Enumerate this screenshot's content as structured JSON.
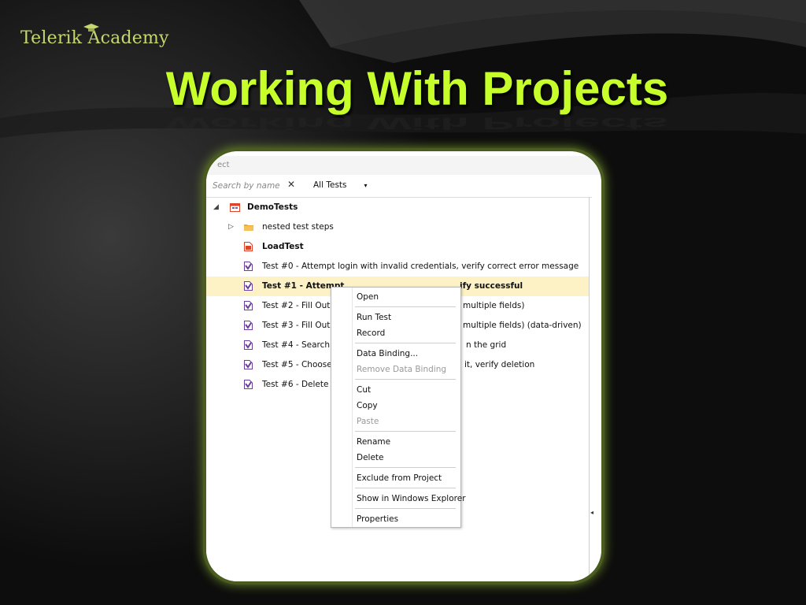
{
  "logo": {
    "text": "Telerik Academy"
  },
  "title": "Working With Projects",
  "panel": {
    "header": "ect",
    "search_placeholder": "Search by name",
    "clear_glyph": "✕",
    "filter": {
      "label": "All Tests",
      "arrow": "▾"
    }
  },
  "tree": {
    "root": "DemoTests",
    "items": [
      {
        "label": "nested test steps",
        "type": "folder"
      },
      {
        "label": "LoadTest",
        "type": "load"
      },
      {
        "label": "Test #0 - Attempt login with invalid credentials, verify correct error message",
        "type": "test"
      },
      {
        "label": "Test #1 - Attempt login with valid credentials, verify successful",
        "type": "test",
        "selected": true,
        "visible_prefix": "Test #1 - Attempt",
        "visible_suffix": "ify successful"
      },
      {
        "label_prefix": "Test #2 - Fill Out a",
        "label_suffix": "multiple fields)",
        "type": "test"
      },
      {
        "label_prefix": "Test #3 - Fill Out a",
        "label_suffix": "multiple fields) (data-driven)",
        "type": "test"
      },
      {
        "label_prefix": "Test #4 - Search a",
        "label_suffix": "n the grid",
        "type": "test"
      },
      {
        "label_prefix": "Test #5 - Choose s",
        "label_suffix": "it, verify deletion",
        "type": "test"
      },
      {
        "label_prefix": "Test #6 - Delete m",
        "type": "test"
      }
    ]
  },
  "context_menu": {
    "items": [
      {
        "label": "Open",
        "enabled": true
      },
      {
        "label": "Run Test",
        "enabled": true
      },
      {
        "label": "Record",
        "enabled": true
      },
      {
        "label": "Data Binding...",
        "enabled": true
      },
      {
        "label": "Remove Data Binding",
        "enabled": false
      },
      {
        "label": "Cut",
        "enabled": true
      },
      {
        "label": "Copy",
        "enabled": true
      },
      {
        "label": "Paste",
        "enabled": false
      },
      {
        "label": "Rename",
        "enabled": true
      },
      {
        "label": "Delete",
        "enabled": true
      },
      {
        "label": "Exclude from Project",
        "enabled": true
      },
      {
        "label": "Show in Windows Explorer",
        "enabled": true
      },
      {
        "label": "Properties",
        "enabled": true
      }
    ]
  },
  "colors": {
    "accent": "#c6ff2a",
    "logo": "#c5d86d",
    "selection": "#fdf2c6",
    "test_icon": "#6a3e9a",
    "folder_icon": "#f0a830",
    "load_icon": "#d9442b",
    "frame_glow": "#6d8b2a"
  },
  "icons": {
    "expand_open": "◢",
    "expand_closed": "▷",
    "scroll_left": "◂"
  }
}
